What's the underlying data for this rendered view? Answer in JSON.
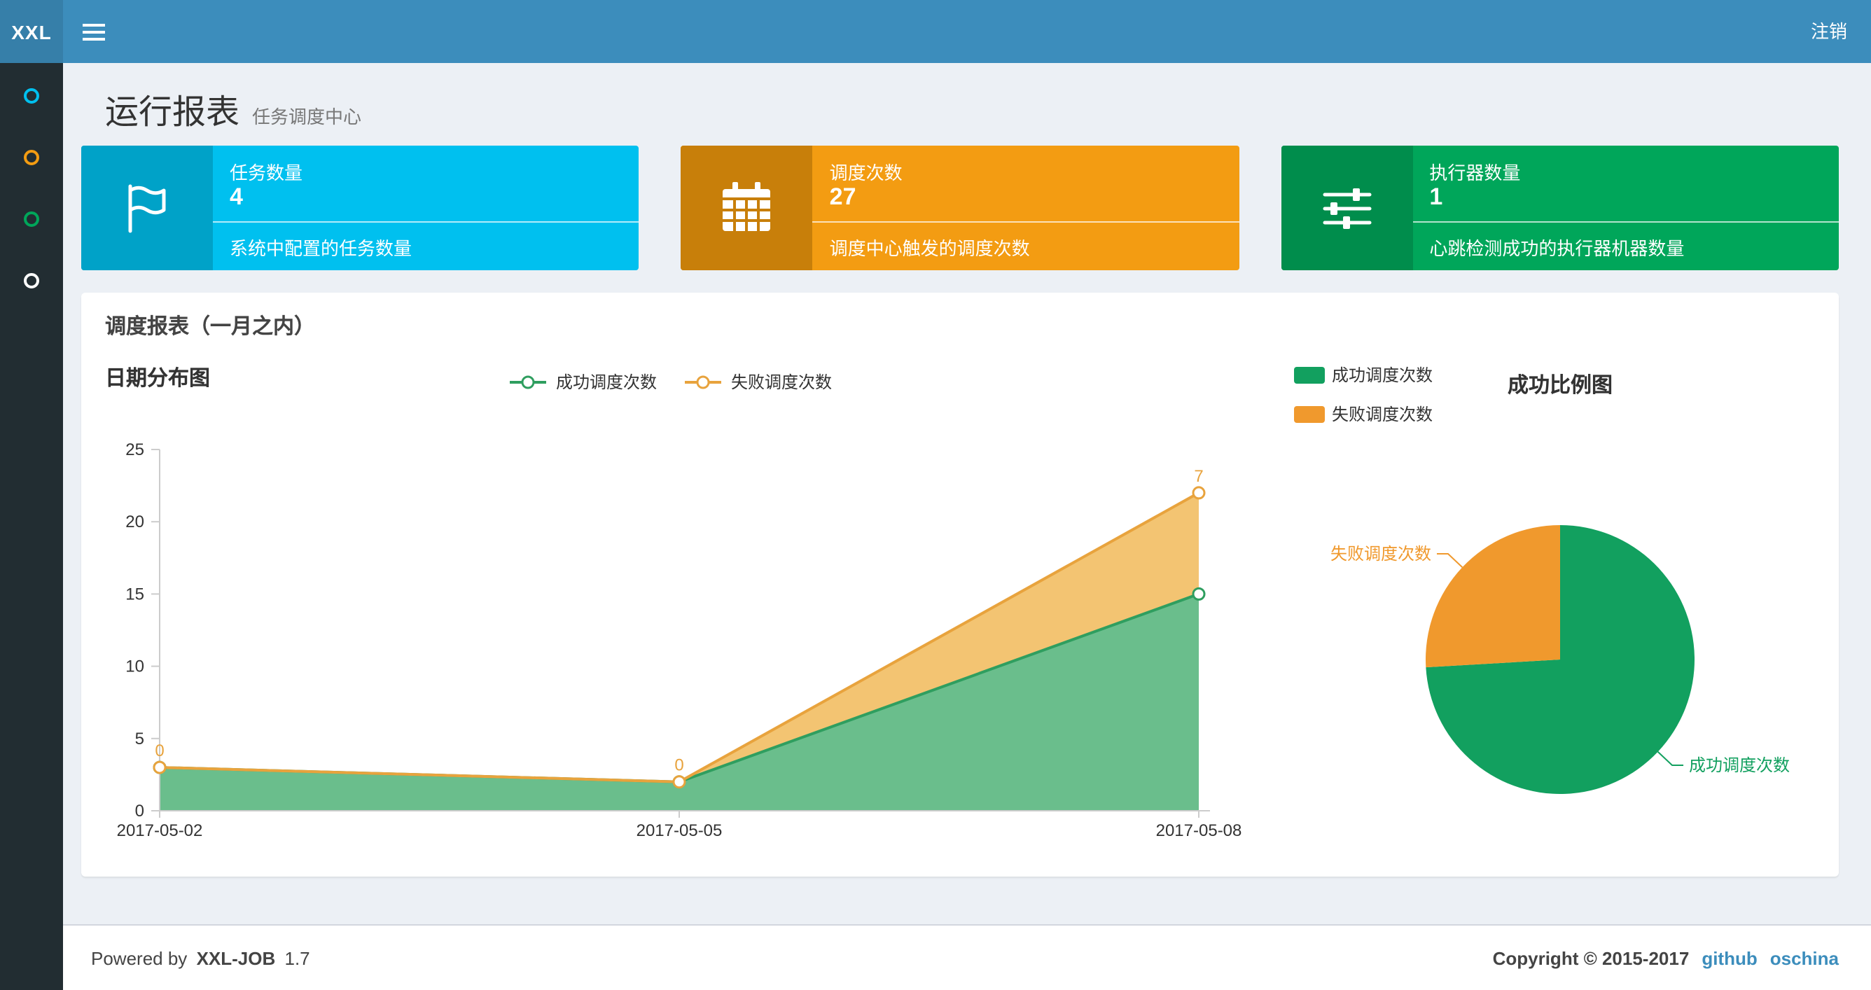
{
  "navbar": {
    "logo": "XXL",
    "logout_label": "注销",
    "bg": "#3c8dbc",
    "logo_bg": "#367fa9"
  },
  "sidebar": {
    "bg": "#222d32",
    "items": [
      {
        "name": "run-report",
        "color": "#00c0ef"
      },
      {
        "name": "job-manage",
        "color": "#f39c12"
      },
      {
        "name": "dispatch-log",
        "color": "#00a65a"
      },
      {
        "name": "executor-manage",
        "color": "#ffffff"
      }
    ]
  },
  "page_header": {
    "title": "运行报表",
    "subtitle": "任务调度中心"
  },
  "info_boxes": [
    {
      "title": "任务数量",
      "value": "4",
      "footer": "系统中配置的任务数量",
      "bg": "#00c0ef",
      "icon_bg": "#00a2c8",
      "icon": "flag-icon"
    },
    {
      "title": "调度次数",
      "value": "27",
      "footer": "调度中心触发的调度次数",
      "bg": "#f39c12",
      "icon_bg": "#c87f0a",
      "icon": "calendar-icon"
    },
    {
      "title": "执行器数量",
      "value": "1",
      "footer": "心跳检测成功的执行器机器数量",
      "bg": "#00a65a",
      "icon_bg": "#008d4c",
      "icon": "sliders-icon"
    }
  ],
  "panel": {
    "title": "调度报表（一月之内）"
  },
  "chart_data": [
    {
      "type": "area",
      "title": "日期分布图",
      "x": [
        "2017-05-02",
        "2017-05-05",
        "2017-05-08"
      ],
      "stacked": true,
      "ylim": [
        0,
        25
      ],
      "yticks": [
        0,
        5,
        10,
        15,
        20,
        25
      ],
      "legend_position": "top-center",
      "series": [
        {
          "name": "成功调度次数",
          "values": [
            3,
            2,
            15
          ],
          "color": "#2f9e5f",
          "area_color": "#6abe8c"
        },
        {
          "name": "失败调度次数",
          "values": [
            0,
            0,
            7
          ],
          "color": "#e8a33d",
          "area_color": "#f3c472",
          "point_labels": [
            "0",
            "0",
            "7"
          ]
        }
      ]
    },
    {
      "type": "pie",
      "title": "成功比例图",
      "legend_position": "top-left",
      "slices": [
        {
          "label": "成功调度次数",
          "value": 20,
          "color": "#12a05f"
        },
        {
          "label": "失败调度次数",
          "value": 7,
          "color": "#f0992d"
        }
      ]
    }
  ],
  "footer": {
    "powered_prefix": "Powered by",
    "product": "XXL-JOB",
    "version": "1.7",
    "copyright": "Copyright © 2015-2017",
    "link_color": "#3c8dbc",
    "links": [
      {
        "label": "github"
      },
      {
        "label": "oschina"
      }
    ]
  }
}
